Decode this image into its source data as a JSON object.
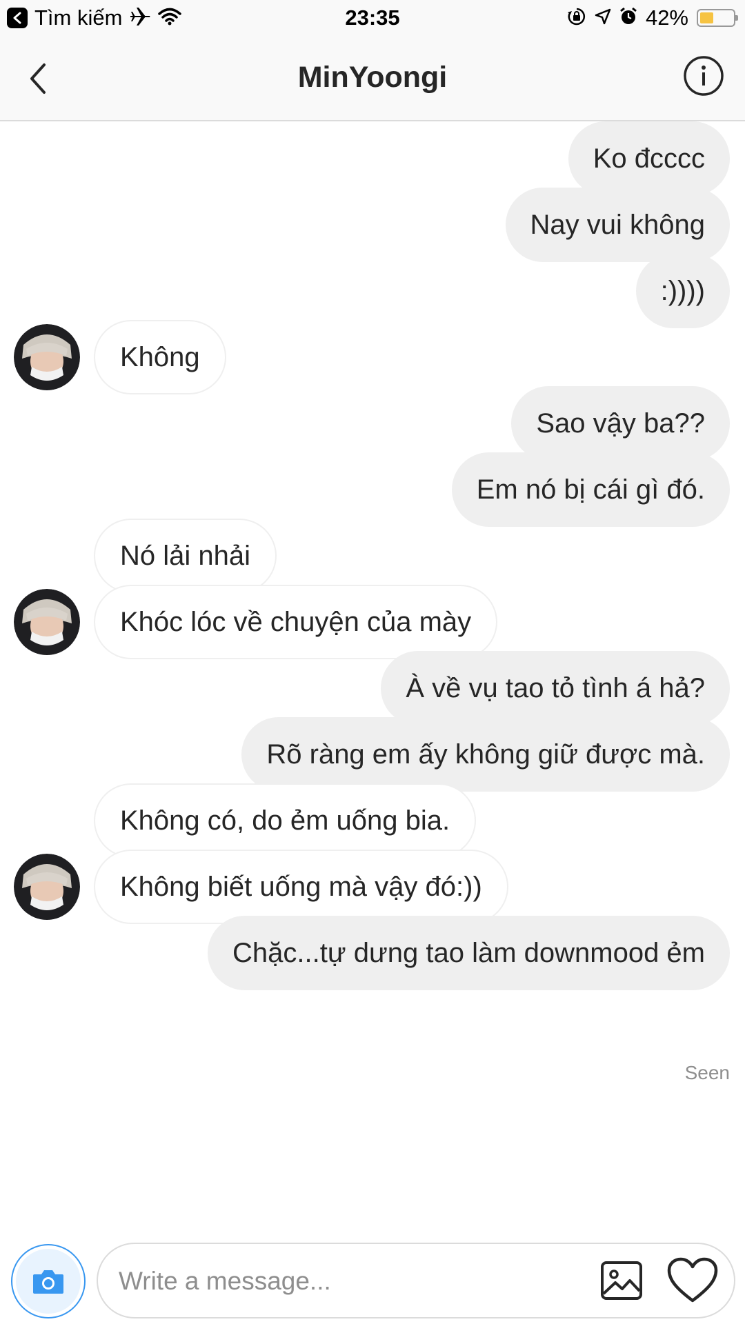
{
  "status_bar": {
    "back_label": "Tìm kiếm",
    "time": "23:35",
    "battery": "42%",
    "battery_level": 0.42,
    "icons": [
      "back-app-icon",
      "airplane-icon",
      "wifi-icon",
      "orientation-lock-icon",
      "location-icon",
      "alarm-icon",
      "battery-icon"
    ]
  },
  "nav": {
    "title": "MinYoongi",
    "back_icon": "chevron-left-icon",
    "info_icon": "info-icon"
  },
  "messages": [
    {
      "from": "me",
      "text": "Ko đcccc"
    },
    {
      "from": "me",
      "text": "Nay vui không"
    },
    {
      "from": "me",
      "text": ":))))"
    },
    {
      "from": "them",
      "text": "Không",
      "avatar": true
    },
    {
      "from": "me",
      "text": "Sao vậy ba??"
    },
    {
      "from": "me",
      "text": "Em nó bị cái gì đó."
    },
    {
      "from": "them",
      "text": "Nó lải nhải",
      "avatar": false
    },
    {
      "from": "them",
      "text": "Khóc lóc về chuyện của mày",
      "avatar": true
    },
    {
      "from": "me",
      "text": "À về vụ tao tỏ tình á hả?"
    },
    {
      "from": "me",
      "text": "Rõ ràng em ấy không giữ được mà."
    },
    {
      "from": "them",
      "text": "Không có, do ẻm uống bia.",
      "avatar": false
    },
    {
      "from": "them",
      "text": "Không biết uống mà vậy đó:))",
      "avatar": true
    },
    {
      "from": "me",
      "text": "Chặc...tự dưng tao làm downmood ẻm"
    }
  ],
  "seen_label": "Seen",
  "composer": {
    "placeholder": "Write a message...",
    "value": "",
    "camera_icon": "camera-icon",
    "gallery_icon": "gallery-icon",
    "heart_icon": "heart-icon"
  },
  "colors": {
    "accent": "#3897f0",
    "outgoing_bubble": "#efefef",
    "incoming_border": "#efefef",
    "muted_text": "#8e8e8e",
    "battery": "#f6c342"
  }
}
